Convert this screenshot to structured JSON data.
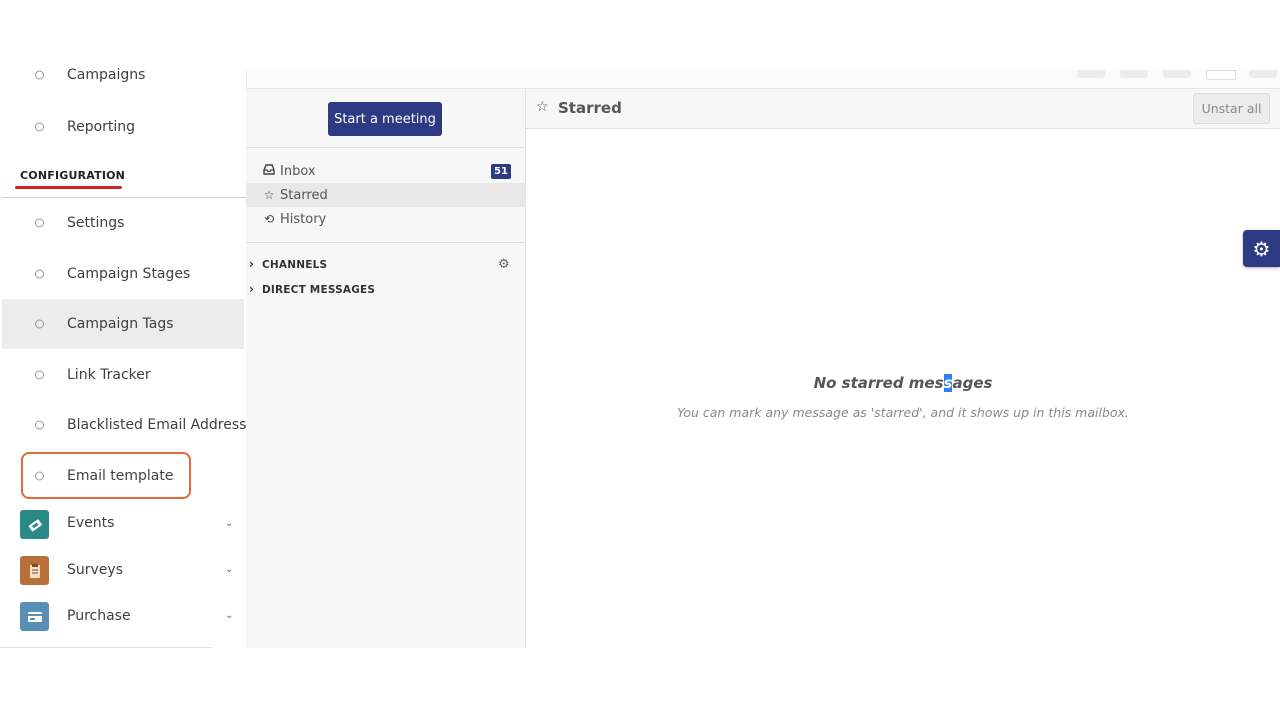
{
  "sidebar": {
    "items_top": [
      {
        "label": "Campaigns"
      },
      {
        "label": "Reporting"
      }
    ],
    "configuration_heading": "CONFIGURATION",
    "config_items": [
      {
        "label": "Settings"
      },
      {
        "label": "Campaign Stages"
      },
      {
        "label": "Campaign Tags",
        "active": true
      },
      {
        "label": "Link Tracker"
      },
      {
        "label": "Blacklisted Email Addresses"
      },
      {
        "label": "Email template",
        "highlighted": true
      }
    ],
    "apps": [
      {
        "label": "Events",
        "icon": "ticket-icon",
        "color": "#2b8a85"
      },
      {
        "label": "Surveys",
        "icon": "clipboard-icon",
        "color": "#b96f3a"
      },
      {
        "label": "Purchase",
        "icon": "credit-card-icon",
        "color": "#5a8fb5"
      }
    ]
  },
  "discuss": {
    "meeting_button": "Start a meeting",
    "mailboxes": [
      {
        "label": "Inbox",
        "icon": "inbox-icon",
        "badge": "51"
      },
      {
        "label": "Starred",
        "icon": "star-icon",
        "active": true
      },
      {
        "label": "History",
        "icon": "history-icon"
      }
    ],
    "categories": [
      {
        "label": "CHANNELS"
      },
      {
        "label": "DIRECT MESSAGES"
      }
    ]
  },
  "main": {
    "title": "Starred",
    "unstar_button": "Unstar all",
    "empty_title_a": "No starred mes",
    "empty_title_sel": "s",
    "empty_title_b": "ages",
    "empty_subtitle": "You can mark any message as 'starred', and it shows up in this mailbox."
  },
  "colors": {
    "primary": "#2e3a82",
    "highlight_border": "#e06a3c",
    "config_underline": "#d62029"
  }
}
